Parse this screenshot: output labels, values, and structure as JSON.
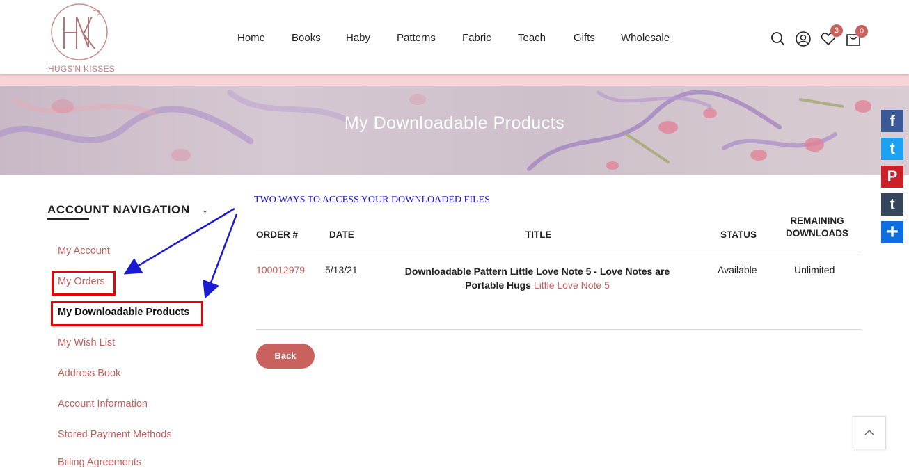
{
  "brand": {
    "logo_text": "HUGS'N KISSES",
    "accent": "#c9625f",
    "link_color": "#c1605d"
  },
  "nav": {
    "items": [
      "Home",
      "Books",
      "Haby",
      "Patterns",
      "Fabric",
      "Teach",
      "Gifts",
      "Wholesale"
    ]
  },
  "header_icons": {
    "search": "search-icon",
    "account": "user-icon",
    "wishlist": "heart-icon",
    "wishlist_count": "3",
    "cart": "cart-icon",
    "cart_count": "0"
  },
  "banner": {
    "title": "My Downloadable Products"
  },
  "sidebar": {
    "title": "ACCOUNT NAVIGATION",
    "items": [
      {
        "label": "My Account"
      },
      {
        "label": "My Orders"
      },
      {
        "label": "My Downloadable Products"
      },
      {
        "label": "My Wish List"
      },
      {
        "label": "Address Book"
      },
      {
        "label": "Account Information"
      },
      {
        "label": "Stored Payment Methods"
      },
      {
        "label": "Billing Agreements"
      }
    ]
  },
  "annotation": {
    "text": "TWO WAYS TO ACCESS YOUR DOWNLOADED FILES",
    "color": "#1a1ad0"
  },
  "table": {
    "headers": [
      "ORDER #",
      "DATE",
      "TITLE",
      "STATUS",
      "REMAINING",
      "DOWNLOADS"
    ],
    "rows": [
      {
        "order": "100012979",
        "date": "5/13/21",
        "title_line1": "Downloadable Pattern Little Love Note 5 - Love Notes are",
        "title_line2": "Portable Hugs",
        "link": "Little Love Note 5",
        "status": "Available",
        "remaining": "Unlimited"
      }
    ]
  },
  "back_label": "Back",
  "social": [
    "facebook-icon",
    "twitter-icon",
    "pinterest-icon",
    "tumblr-icon",
    "share-icon"
  ],
  "social_glyphs": [
    "f",
    "t",
    "P",
    "t",
    "+"
  ],
  "social_colors": [
    "#3b5998",
    "#1da1f2",
    "#cb2027",
    "#35465c",
    "#0d6ee0"
  ]
}
